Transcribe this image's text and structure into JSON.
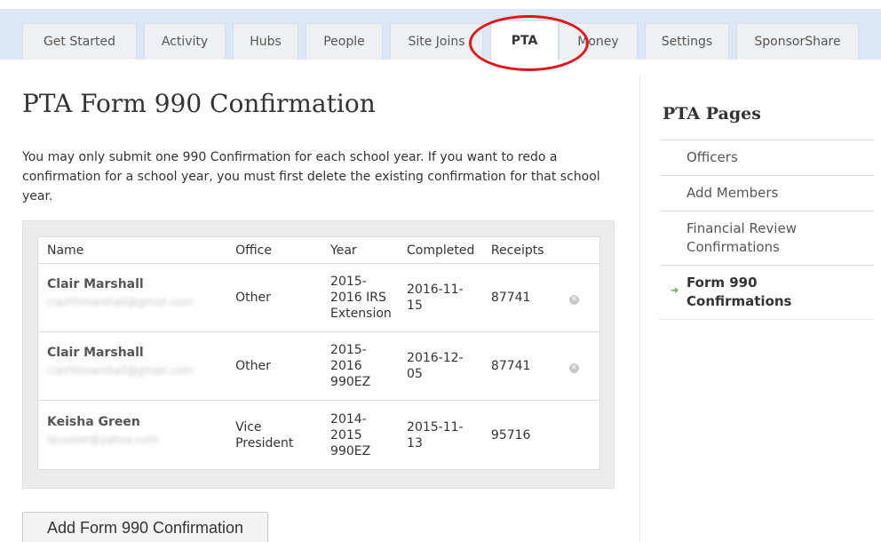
{
  "tabs": [
    {
      "label": "Get Started"
    },
    {
      "label": "Activity"
    },
    {
      "label": "Hubs"
    },
    {
      "label": "People"
    },
    {
      "label": "Site Joins"
    },
    {
      "label": "PTA",
      "active": true
    },
    {
      "label": "Money"
    },
    {
      "label": "Settings"
    },
    {
      "label": "SponsorShare"
    }
  ],
  "colors": {
    "tab_bar": "#dbe7f7",
    "highlight": "#e2141c",
    "arrow": "#5fae3a"
  },
  "main": {
    "title": "PTA Form 990 Confirmation",
    "intro": "You may only submit one 990 Confirmation for each school year. If you want to redo a confirmation for a school year, you must first delete the existing confirmation for that school year.",
    "table": {
      "headers": [
        "Name",
        "Office",
        "Year",
        "Completed",
        "Receipts"
      ],
      "rows": [
        {
          "name": "Clair Marshall",
          "email": "clairthmarshall@gmail.com",
          "office": "Other",
          "year": "2015-2016 IRS Extension",
          "completed": "2016-11-15",
          "receipts": "87741",
          "deletable": true
        },
        {
          "name": "Clair Marshall",
          "email": "clairthmarshall@gmail.com",
          "office": "Other",
          "year": "2015-2016 990EZ",
          "completed": "2016-12-05",
          "receipts": "87741",
          "deletable": true
        },
        {
          "name": "Keisha Green",
          "email": "lacoolet@yahoo.com",
          "office": "Vice President",
          "year": "2014-2015 990EZ",
          "completed": "2015-11-13",
          "receipts": "95716",
          "deletable": false
        }
      ]
    },
    "add_button": "Add Form 990 Confirmation"
  },
  "sidebar": {
    "title": "PTA Pages",
    "items": [
      {
        "label": "Officers"
      },
      {
        "label": "Add Members"
      },
      {
        "label": "Financial Review Confirmations"
      },
      {
        "label": "Form 990 Confirmations",
        "active": true
      }
    ]
  }
}
